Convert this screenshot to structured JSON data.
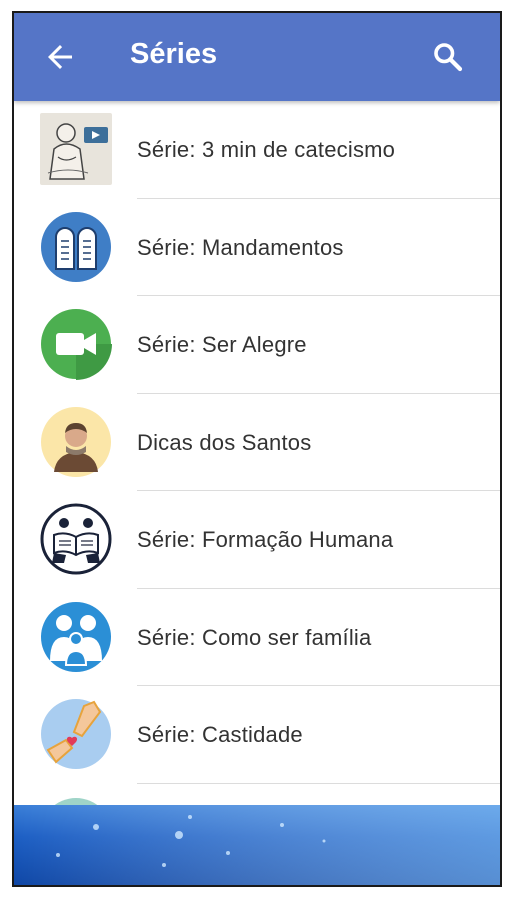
{
  "header": {
    "title": "Séries",
    "back_icon": "arrow-left-icon",
    "search_icon": "search-icon",
    "color": "#5575c7"
  },
  "series": [
    {
      "label": "Série: 3 min de catecismo",
      "icon": "catechism-video-icon"
    },
    {
      "label": "Série: Mandamentos",
      "icon": "tablets-icon"
    },
    {
      "label": "Série: Ser Alegre",
      "icon": "video-camera-icon"
    },
    {
      "label": "Dicas dos Santos",
      "icon": "saint-avatar-icon"
    },
    {
      "label": "Série: Formação Humana",
      "icon": "reading-book-icon"
    },
    {
      "label": "Série: Como ser família",
      "icon": "family-icon"
    },
    {
      "label": "Série: Castidade",
      "icon": "hands-heart-icon"
    }
  ]
}
